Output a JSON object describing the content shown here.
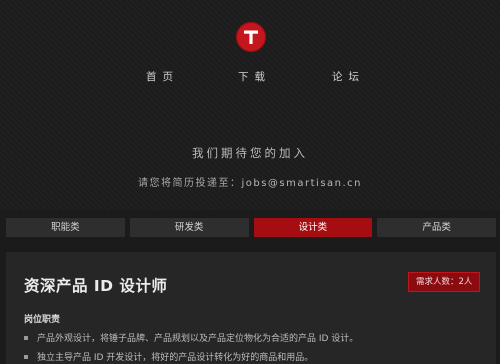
{
  "nav": {
    "items": [
      "首页",
      "下载",
      "论坛"
    ]
  },
  "hero": {
    "tagline": "我们期待您的加入",
    "contact_prefix": "请您将简历投递至：",
    "contact_email": "jobs@smartisan.cn"
  },
  "tabs": [
    {
      "label": "职能类",
      "active": false
    },
    {
      "label": "研发类",
      "active": false
    },
    {
      "label": "设计类",
      "active": true
    },
    {
      "label": "产品类",
      "active": false
    }
  ],
  "job": {
    "title": "资深产品 ID 设计师",
    "headcount": "需求人数：2人",
    "section_label": "岗位职责",
    "duties": [
      "产品外观设计，将锤子品牌、产品规划以及产品定位物化为合适的产品 ID 设计。",
      "独立主导产品 ID 开发设计，将好的产品设计转化为好的商品和用品。"
    ]
  },
  "colors": {
    "brand_red": "#c4161c",
    "active_tab": "#a50d12",
    "background": "#1b1b1b",
    "panel": "#262626"
  },
  "icons": {
    "logo": "smartisan-t-logo-icon",
    "bullet": "square-bullet-icon"
  }
}
